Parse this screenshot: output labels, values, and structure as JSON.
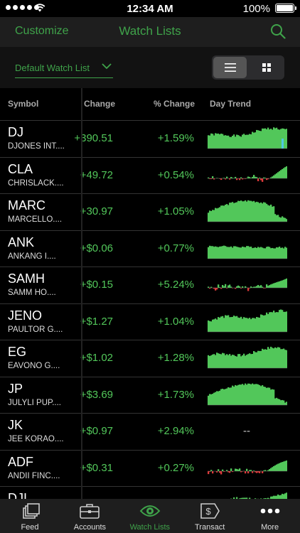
{
  "status": {
    "time": "12:34 AM",
    "battery": "100%"
  },
  "nav": {
    "left_action": "Customize",
    "title": "Watch Lists",
    "search_icon": "search-icon"
  },
  "watchlist": {
    "selected": "Default Watch List"
  },
  "columns": {
    "symbol": "Symbol",
    "change": "Change",
    "pct_change": "% Change",
    "trend": "Day Trend"
  },
  "rows": [
    {
      "symbol": "DJ",
      "name": "DJONES INT....",
      "change": "+390.51",
      "pct": "+1.59%",
      "trend": "up",
      "seed": 1
    },
    {
      "symbol": "CLA",
      "name": "CHRISLACK....",
      "change": "+49.72",
      "pct": "+0.54%",
      "trend": "mixed",
      "seed": 2
    },
    {
      "symbol": "MARC",
      "name": "MARCELLO....",
      "change": "+30.97",
      "pct": "+1.05%",
      "trend": "hump",
      "seed": 3
    },
    {
      "symbol": "ANK",
      "name": "ANKANG I....",
      "change": "+$0.06",
      "pct": "+0.77%",
      "trend": "flat",
      "seed": 4
    },
    {
      "symbol": "SAMH",
      "name": "SAMM HO....",
      "change": "+$0.15",
      "pct": "+5.24%",
      "trend": "mixed",
      "seed": 5
    },
    {
      "symbol": "JENO",
      "name": "PAULTOR G....",
      "change": "+$1.27",
      "pct": "+1.04%",
      "trend": "up",
      "seed": 6
    },
    {
      "symbol": "EG",
      "name": "EAVONO G....",
      "change": "+$1.02",
      "pct": "+1.28%",
      "trend": "up",
      "seed": 7
    },
    {
      "symbol": "JP",
      "name": "JULYLI PUP....",
      "change": "+$3.69",
      "pct": "+1.73%",
      "trend": "hump",
      "seed": 8
    },
    {
      "symbol": "JK",
      "name": "JEE KORAO....",
      "change": "+$0.97",
      "pct": "+2.94%",
      "trend": "none",
      "seed": 9
    },
    {
      "symbol": "ADF",
      "name": "ANDII FINC....",
      "change": "+$0.31",
      "pct": "+0.27%",
      "trend": "mixed",
      "seed": 10
    },
    {
      "symbol": "DJI",
      "name": "",
      "change": "",
      "pct": "",
      "trend": "up",
      "seed": 11
    }
  ],
  "no_trend_text": "--",
  "tabs": [
    {
      "label": "Feed",
      "icon": "feed-icon",
      "active": false
    },
    {
      "label": "Accounts",
      "icon": "briefcase-icon",
      "active": false
    },
    {
      "label": "Watch Lists",
      "icon": "eye-icon",
      "active": true
    },
    {
      "label": "Transact",
      "icon": "dollar-tag-icon",
      "active": false
    },
    {
      "label": "More",
      "icon": "more-icon",
      "active": false
    }
  ],
  "colors": {
    "accent": "#3fa34a",
    "positive": "#52c75a",
    "negative": "#e03a3a",
    "highlight": "#4ec8e0"
  }
}
